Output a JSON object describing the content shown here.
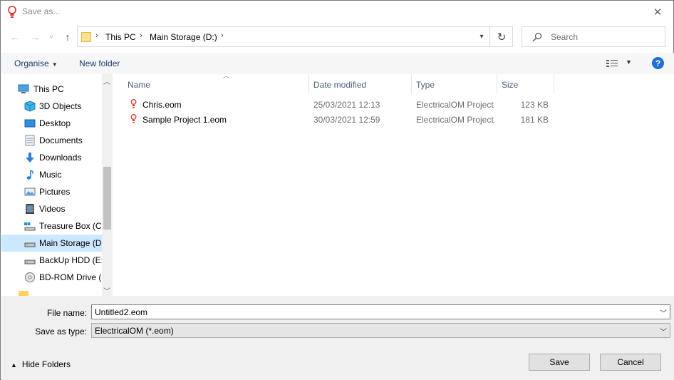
{
  "window": {
    "title": "Save as..."
  },
  "nav": {
    "back": "←",
    "forward": "→",
    "recent_dropdown": "˅",
    "up": "↑"
  },
  "address": {
    "crumbs": [
      "This PC",
      "Main Storage (D:)"
    ],
    "separator": "›"
  },
  "search": {
    "placeholder": "Search"
  },
  "toolbar": {
    "organise": "Organise",
    "new_folder": "New folder",
    "help": "?"
  },
  "sidebar": {
    "items": [
      {
        "label": "This PC",
        "icon": "computer-icon"
      },
      {
        "label": "3D Objects",
        "icon": "3d-objects-icon"
      },
      {
        "label": "Desktop",
        "icon": "desktop-icon"
      },
      {
        "label": "Documents",
        "icon": "documents-icon"
      },
      {
        "label": "Downloads",
        "icon": "downloads-icon"
      },
      {
        "label": "Music",
        "icon": "music-icon"
      },
      {
        "label": "Pictures",
        "icon": "pictures-icon"
      },
      {
        "label": "Videos",
        "icon": "videos-icon"
      },
      {
        "label": "Treasure Box (C:)",
        "icon": "drive-icon"
      },
      {
        "label": "Main Storage (D:)",
        "icon": "drive-icon",
        "selected": true
      },
      {
        "label": "BackUp HDD (E:)",
        "icon": "drive-icon"
      },
      {
        "label": "BD-ROM Drive (F:)",
        "icon": "disc-drive-icon"
      }
    ]
  },
  "columns": {
    "name": "Name",
    "date_modified": "Date modified",
    "type": "Type",
    "size": "Size"
  },
  "files": [
    {
      "name": "Chris.eom",
      "date": "25/03/2021 12:13",
      "type": "ElectricalOM Project",
      "size": "123 KB"
    },
    {
      "name": "Sample Project 1.eom",
      "date": "30/03/2021 12:59",
      "type": "ElectricalOM Project",
      "size": "181 KB"
    }
  ],
  "form": {
    "file_name_label": "File name:",
    "file_name_value": "Untitled2.eom",
    "save_type_label": "Save as type:",
    "save_type_value": "ElectricalOM (*.eom)"
  },
  "buttons": {
    "hide_folders": "Hide Folders",
    "save": "Save",
    "cancel": "Cancel"
  },
  "colors": {
    "selection": "#cce8ff",
    "accent": "#1f6fd6",
    "app_icon": "#e0302f"
  }
}
